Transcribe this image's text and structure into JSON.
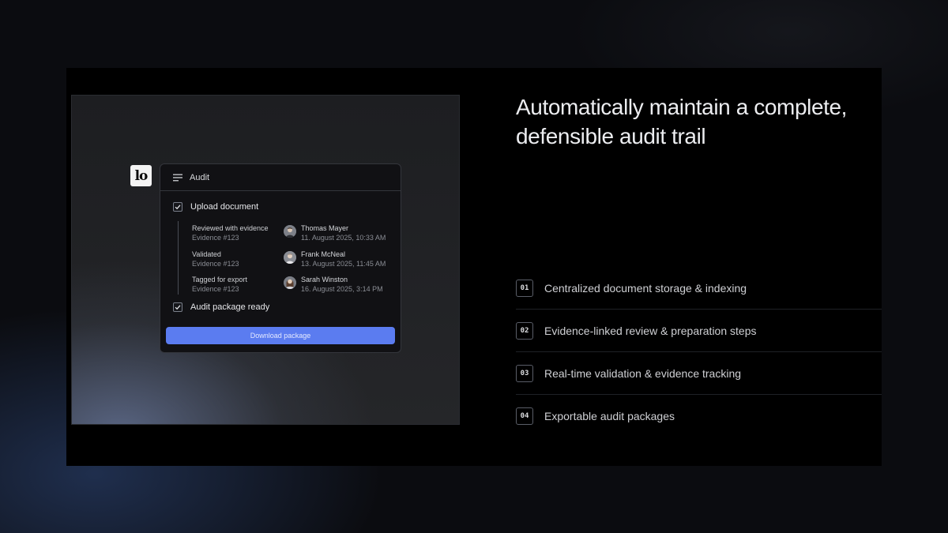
{
  "logo": {
    "text": "lo"
  },
  "audit_card": {
    "title": "Audit",
    "steps": [
      {
        "label": "Upload document",
        "checked": true
      },
      {
        "label": "Audit package ready",
        "checked": true
      }
    ],
    "events": [
      {
        "title": "Reviewed with evidence",
        "evidence": "Evidence #123",
        "user": "Thomas Mayer",
        "timestamp": "11. August 2025, 10:33 AM"
      },
      {
        "title": "Validated",
        "evidence": "Evidence #123",
        "user": "Frank McNeal",
        "timestamp": "13. August 2025, 11:45 AM"
      },
      {
        "title": "Tagged for export",
        "evidence": "Evidence #123",
        "user": "Sarah Winston",
        "timestamp": "16. August 2025, 3:14 PM"
      }
    ],
    "download_label": "Download package"
  },
  "headline": "Automatically maintain a complete, defensible audit trail",
  "features": [
    {
      "num": "01",
      "label": "Centralized document storage & indexing"
    },
    {
      "num": "02",
      "label": "Evidence-linked review & preparation steps"
    },
    {
      "num": "03",
      "label": "Real-time validation & evidence tracking"
    },
    {
      "num": "04",
      "label": "Exportable audit packages"
    }
  ],
  "colors": {
    "accent": "#5b7cf0",
    "background": "#000000",
    "text": "#ecedf0"
  }
}
